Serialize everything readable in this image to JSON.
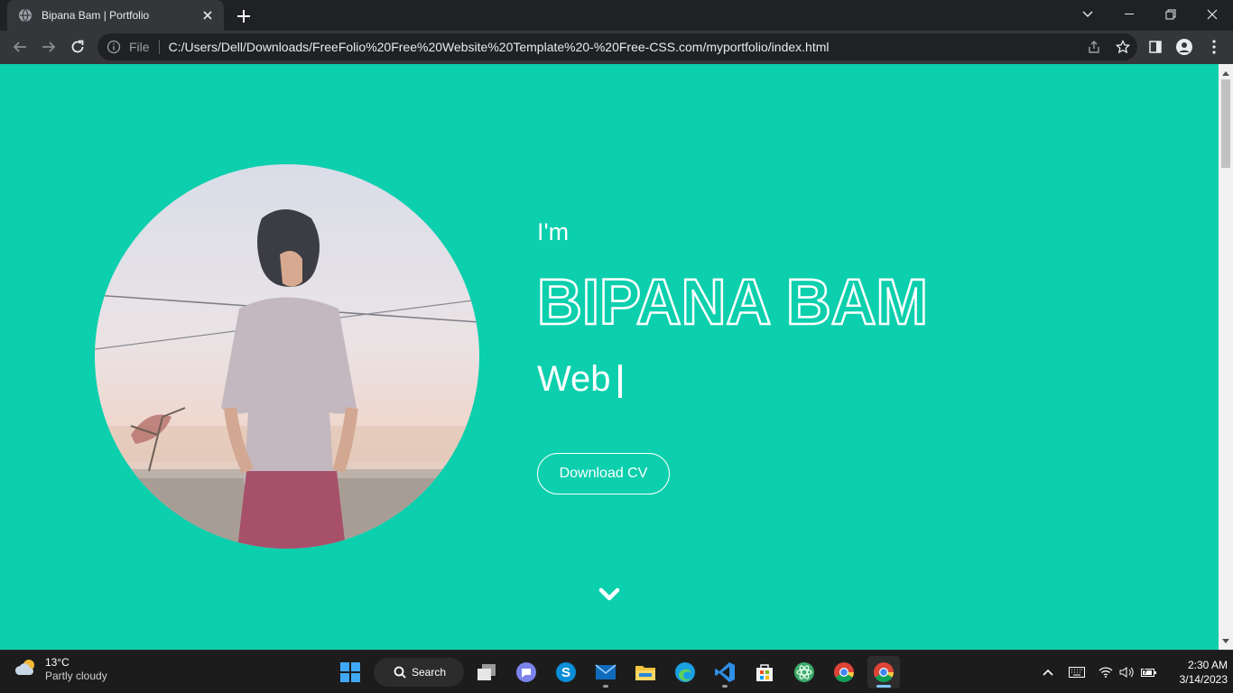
{
  "browser": {
    "tab_title": "Bipana Bam | Portfolio",
    "address_scheme_label": "File",
    "url": "C:/Users/Dell/Downloads/FreeFolio%20Free%20Website%20Template%20-%20Free-CSS.com/myportfolio/index.html"
  },
  "hero": {
    "intro": "I'm",
    "name": "BIPANA BAM",
    "role_typed": "Web",
    "cv_button": "Download CV"
  },
  "colors": {
    "page_background": "#0ccfad",
    "text": "#ffffff",
    "browser_frame": "#202124",
    "browser_toolbar": "#35363a",
    "taskbar": "#1c1c1c"
  },
  "taskbar": {
    "weather_temp": "13°C",
    "weather_condition": "Partly cloudy",
    "search_label": "Search",
    "apps": [
      "start-icon",
      "search-icon",
      "task-view-icon",
      "teams-chat-icon",
      "skype-icon",
      "mail-icon",
      "file-explorer-icon",
      "edge-icon",
      "vscode-icon",
      "microsoft-store-icon",
      "atom-icon",
      "chrome-icon",
      "chrome-icon"
    ],
    "time": "2:30 AM",
    "date": "3/14/2023"
  }
}
